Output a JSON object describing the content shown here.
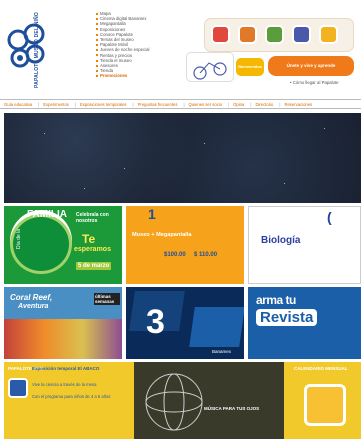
{
  "logo": {
    "text": "PAPALOTE MUSEO DEL NIÑO"
  },
  "menu": {
    "items": [
      "Mapa",
      "Cinema digital Banamex",
      "Megapantalla",
      "Exposiciones",
      "Conoce Papalote",
      "Temas del museo",
      "Papalote Móvil",
      "Jueves de noche especial",
      "Rentas y precios",
      "Tienda el museo",
      "Asesores",
      "Tienda",
      "Promociones"
    ]
  },
  "links": {
    "como_llegar": "• Cómo llegar al Papalote"
  },
  "promo": {
    "bienvenidos": "Bienvenidos",
    "orange": "Únete y vive y aprende"
  },
  "nav": [
    "Guía educativa",
    "Experimentos",
    "Exposiciones temporales",
    "Preguntas frecuentes",
    "Quienes ser socio",
    "Opina",
    "Directorio",
    "Reservaciones"
  ],
  "tiles": {
    "familia": {
      "title": "FAMILIA",
      "prefix": "Día de la",
      "celebrate": "Celebrala con nosotros",
      "te": "Te",
      "esperamos": "esperamos",
      "date": "5 de marzo"
    },
    "museo": {
      "num": "1",
      "title": "Museo + Megapantalla",
      "price1": "$100.00",
      "price2": "$ 110.00"
    },
    "bio": {
      "title": "Biología"
    },
    "coral": {
      "title": "Coral Reef,",
      "subtitle": "Aventura",
      "badge": "últimas semanas"
    },
    "tres": {
      "num": "3",
      "sponsor": "Banamex"
    },
    "revista": {
      "line1": "arma tu",
      "line2": "Revista"
    },
    "bottom": {
      "left_heading": "PAPALOTE VIVE",
      "text1": "Exposición temporal El ABACO",
      "text2": "Vive la ciencia a través de la mesa",
      "text3": "Con el programa para niños de 4 a 6 años",
      "center": "MÚSICA PARA TUS OJOS",
      "right_heading": "CALENDARIO MENSUAL"
    }
  },
  "colors": {
    "orange": "#f08000",
    "navy": "#1d4f9b",
    "green": "#1c9a3a",
    "yellow": "#f2c92b"
  }
}
